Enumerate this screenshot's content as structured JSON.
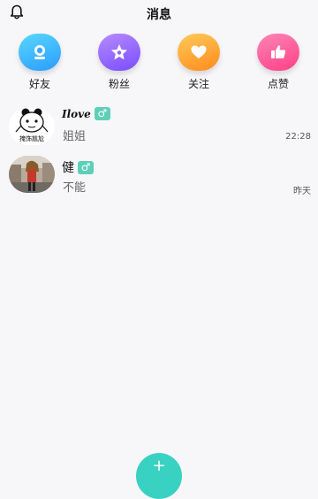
{
  "header": {
    "title": "消息",
    "bell_icon": "bell-icon"
  },
  "categories": [
    {
      "label": "好友",
      "icon": "friend-icon",
      "color_from": "#5ad7ff",
      "color_to": "#2a9cff"
    },
    {
      "label": "粉丝",
      "icon": "star-icon",
      "color_from": "#b58bff",
      "color_to": "#7a4dff"
    },
    {
      "label": "关注",
      "icon": "heart-icon",
      "color_from": "#ffcb57",
      "color_to": "#ff8a1f"
    },
    {
      "label": "点赞",
      "icon": "thumbs-up-icon",
      "color_from": "#ff86b5",
      "color_to": "#ff3f86"
    }
  ],
  "messages": [
    {
      "name": "Ilove",
      "gender": "♂",
      "preview": "姐姐",
      "time": "22:28",
      "avatar_caption": "掩饰尴尬"
    },
    {
      "name": "健",
      "gender": "♂",
      "preview": "不能",
      "time": "昨天"
    }
  ],
  "fab": {
    "symbol": "+"
  }
}
